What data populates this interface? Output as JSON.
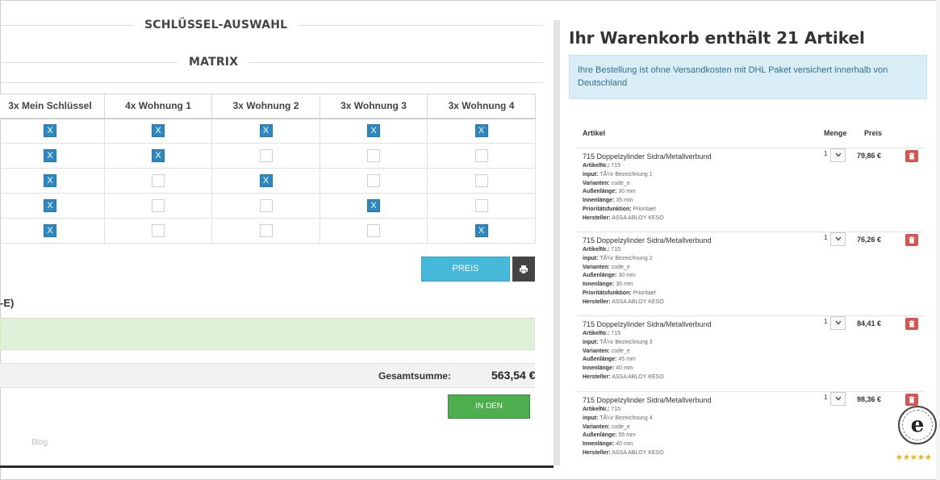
{
  "left": {
    "section_title": "SCHLÜSSEL-AUSWAHL",
    "matrix_title": "MATRIX",
    "columns": [
      "3x Mein Schlüssel",
      "4x Wohnung 1",
      "3x Wohnung 2",
      "3x Wohnung 3",
      "3x Wohnung 4"
    ],
    "check_mark": "X",
    "rows": [
      [
        true,
        true,
        true,
        true,
        true
      ],
      [
        true,
        true,
        false,
        false,
        false
      ],
      [
        true,
        false,
        true,
        false,
        false
      ],
      [
        true,
        false,
        false,
        true,
        false
      ],
      [
        true,
        false,
        false,
        false,
        true
      ]
    ],
    "update_button": "PREIS AKTUALISIEREN",
    "price_suffix": "-E)",
    "total_label": "Gesamtsumme:",
    "total_value": "563,54 €",
    "cart_button": "IN DEN WARENKORB",
    "blog_link": "Blog"
  },
  "cart": {
    "title": "Ihr Warenkorb enthält 21 Artikel",
    "info": "Ihre Bestellung ist ohne Versandkosten mit DHL Paket versichert innerhalb von Deutschland",
    "headers": {
      "article": "Artikel",
      "quantity": "Menge",
      "price": "Preis"
    },
    "items": [
      {
        "name": "715 Doppelzylinder Sidra/Metallverbund",
        "details": [
          {
            "k": "ArtikelNr.:",
            "v": "715"
          },
          {
            "k": "input:",
            "v": "TÃ¼r Bezeichnung 1"
          },
          {
            "k": "Varianten:",
            "v": "code_e"
          },
          {
            "k": "Außenlänge:",
            "v": "30 mm"
          },
          {
            "k": "Innenlänge:",
            "v": "35 mm"
          },
          {
            "k": "Prioritätsfunktion:",
            "v": "Prioritaet"
          },
          {
            "k": "Hersteller:",
            "v": "ASSA ABLOY KESO"
          }
        ],
        "qty": "1",
        "price": "79,86 €"
      },
      {
        "name": "715 Doppelzylinder Sidra/Metallverbund",
        "details": [
          {
            "k": "ArtikelNr.:",
            "v": "715"
          },
          {
            "k": "input:",
            "v": "TÃ¼r Bezeichnung 2"
          },
          {
            "k": "Varianten:",
            "v": "code_e"
          },
          {
            "k": "Außenlänge:",
            "v": "30 mm"
          },
          {
            "k": "Innenlänge:",
            "v": "30 mm"
          },
          {
            "k": "Prioritätsfunktion:",
            "v": "Prioritaet"
          },
          {
            "k": "Hersteller:",
            "v": "ASSA ABLOY KESO"
          }
        ],
        "qty": "1",
        "price": "76,26 €"
      },
      {
        "name": "715 Doppelzylinder Sidra/Metallverbund",
        "details": [
          {
            "k": "ArtikelNr.:",
            "v": "715"
          },
          {
            "k": "input:",
            "v": "TÃ¼r Bezeichnung 3"
          },
          {
            "k": "Varianten:",
            "v": "code_e"
          },
          {
            "k": "Außenlänge:",
            "v": "45 mm"
          },
          {
            "k": "Innenlänge:",
            "v": "40 mm"
          },
          {
            "k": "Hersteller:",
            "v": "ASSA ABLOY KESO"
          }
        ],
        "qty": "1",
        "price": "84,41 €"
      },
      {
        "name": "715 Doppelzylinder Sidra/Metallverbund",
        "details": [
          {
            "k": "ArtikelNr.:",
            "v": "715"
          },
          {
            "k": "input:",
            "v": "TÃ¼r Bezeichnung 4"
          },
          {
            "k": "Varianten:",
            "v": "code_e"
          },
          {
            "k": "Außenlänge:",
            "v": "55 mm"
          },
          {
            "k": "Innenlänge:",
            "v": "40 mm"
          },
          {
            "k": "Hersteller:",
            "v": "ASSA ABLOY KESO"
          }
        ],
        "qty": "1",
        "price": "98,36 €"
      }
    ]
  },
  "colors": {
    "checked": "#2d88c2",
    "update_button": "#46b8da",
    "cart_button": "#4cae4c",
    "delete_button": "#d9534f",
    "info_box": "#d9edf7",
    "success_box": "#dff0d8"
  },
  "icons": {
    "print": "print-icon",
    "delete": "trash-icon",
    "dropdown": "chevron-down-icon",
    "trust": "trusted-shops-badge"
  }
}
